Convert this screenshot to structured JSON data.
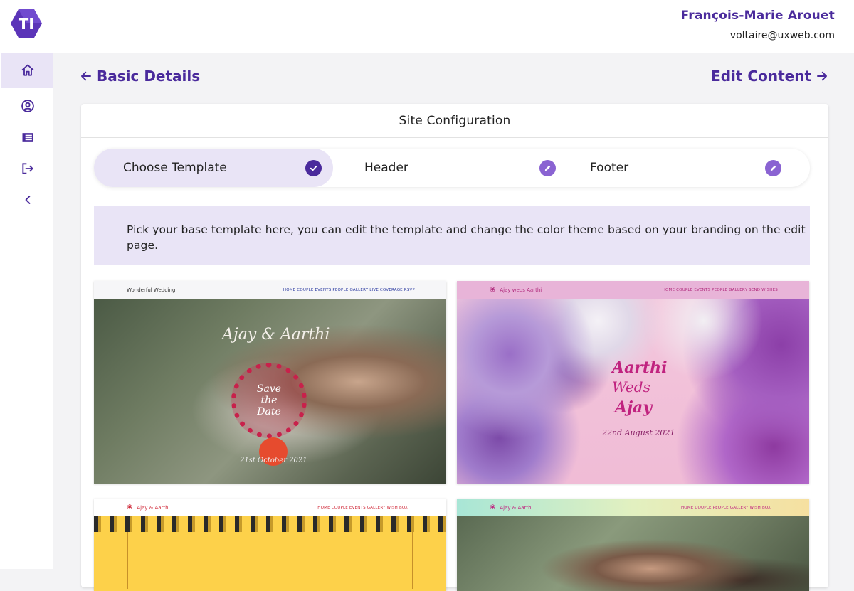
{
  "user": {
    "name": "François-Marie Arouet",
    "email": "voltaire@uxweb.com"
  },
  "logo": {
    "text": "TI",
    "icon": "hexagon-logo"
  },
  "sidebar": {
    "items": [
      {
        "icon": "home-icon",
        "active": true
      },
      {
        "icon": "account-circle-icon",
        "active": false
      },
      {
        "icon": "list-icon",
        "active": false
      },
      {
        "icon": "logout-icon",
        "active": false
      },
      {
        "icon": "chevron-left-icon",
        "active": false
      }
    ]
  },
  "nav": {
    "back_label": "Basic Details",
    "next_label": "Edit Content"
  },
  "card": {
    "title": "Site Configuration"
  },
  "stepper": {
    "steps": [
      {
        "label": "Choose Template",
        "state": "complete",
        "icon": "check-icon"
      },
      {
        "label": "Header",
        "state": "edit",
        "icon": "pencil-icon"
      },
      {
        "label": "Footer",
        "state": "edit",
        "icon": "pencil-icon"
      }
    ]
  },
  "banner": {
    "text": "Pick your base template here, you can edit the template and change the color theme based on your branding on the edit page."
  },
  "templates": [
    {
      "brand": "Wonderful Wedding",
      "menu": "HOME  COUPLE  EVENTS  PEOPLE  GALLERY  LIVE COVERAGE  RSVP",
      "couple": "Ajay & Aarthi",
      "badge": "Save the Date",
      "date": "21st October 2021"
    },
    {
      "brand": "Ajay weds Aarthi",
      "menu": "HOME  COUPLE  EVENTS  PEOPLE  GALLERY  SEND WISHES",
      "line1": "Aarthi",
      "line2": "Weds",
      "line3": "Ajay",
      "date": "22nd August 2021"
    },
    {
      "brand": "Ajay & Aarthi",
      "menu": "HOME  COUPLE  EVENTS  GALLERY  WISH BOX"
    },
    {
      "brand": "Ajay & Aarthi",
      "menu": "HOME  COUPLE  PEOPLE  GALLERY  WISH BOX"
    }
  ],
  "colors": {
    "accent": "#4a2a9c",
    "accent_light": "#e9e4f6",
    "badge": "#8a63d2",
    "badge_done": "#4a2a9c"
  }
}
